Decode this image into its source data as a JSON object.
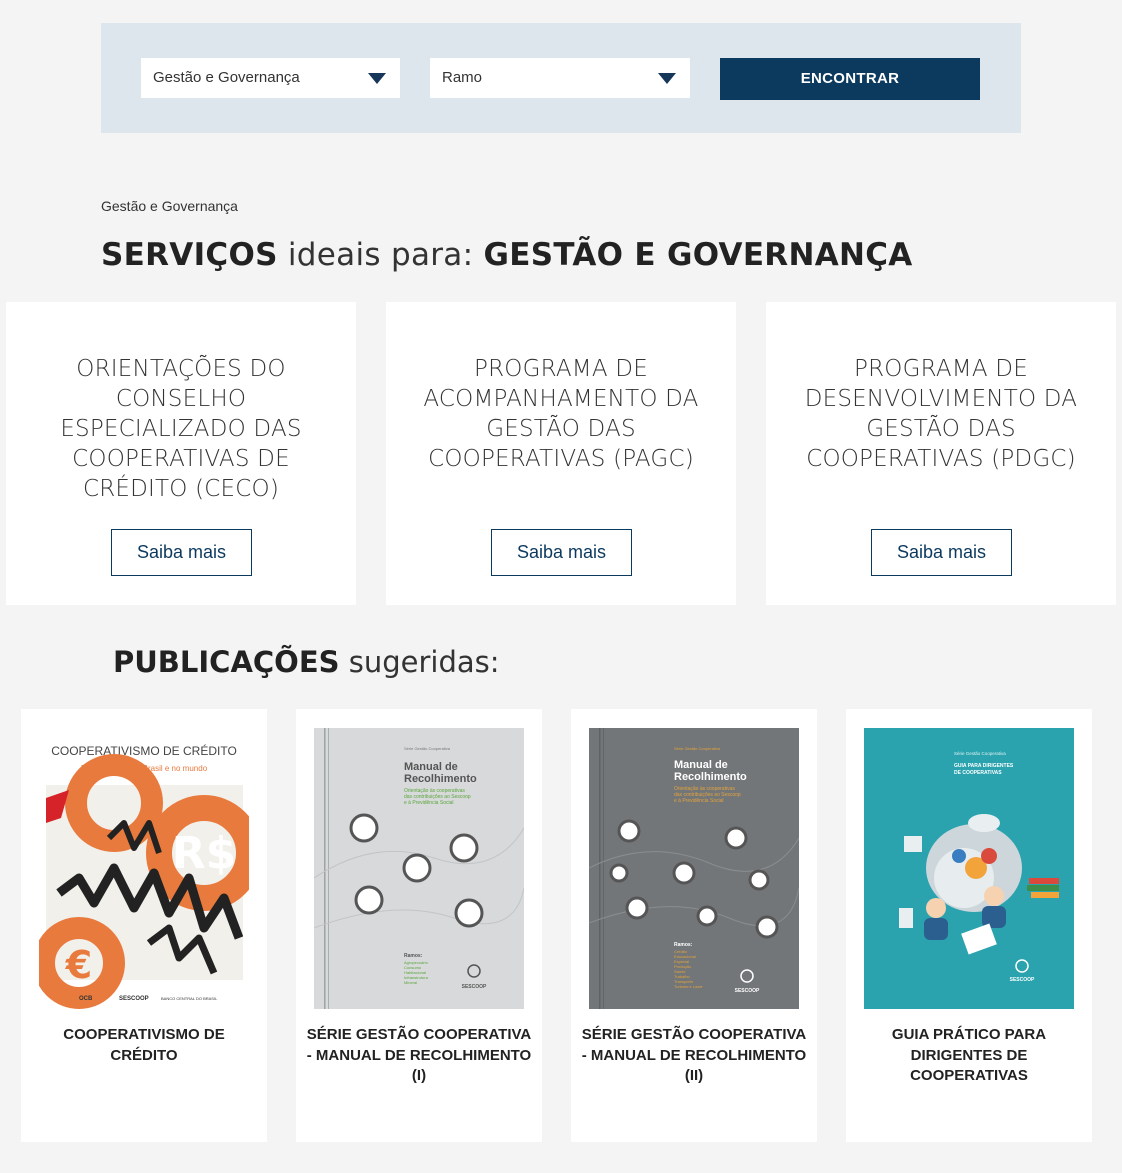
{
  "filters": {
    "theme_value": "Gestão e Governança",
    "branch_value": "Ramo",
    "find_label": "ENCONTRAR"
  },
  "breadcrumb": "Gestão e Governança",
  "services_heading": {
    "bold1": "SERVIÇOS",
    "light": " ideais para: ",
    "bold2": "GESTÃO E GOVERNANÇA"
  },
  "services": [
    {
      "title": "ORIENTAÇÕES DO CONSELHO ESPECIALIZADO DAS COOPERATIVAS DE CRÉDITO (CECO)",
      "button": "Saiba mais"
    },
    {
      "title": "PROGRAMA DE ACOMPANHAMENTO DA GESTÃO DAS COOPERATIVAS (PAGC)",
      "button": "Saiba mais"
    },
    {
      "title": "PROGRAMA DE DESENVOLVIMENTO DA GESTÃO DAS COOPERATIVAS (PDGC)",
      "button": "Saiba mais"
    }
  ],
  "publications_heading": {
    "bold": "PUBLICAÇÕES",
    "light": " sugeridas:"
  },
  "publications": [
    {
      "title": "COOPERATIVISMO DE CRÉDITO",
      "cover": {
        "heading": "COOPERATIVISMO DE CRÉDITO",
        "subheading": "Boas práticas no Brasil e no mundo",
        "footer": [
          "OCB",
          "SESCOOP",
          "BANCO CENTRAL DO BRASIL"
        ]
      }
    },
    {
      "title": "SÉRIE GESTÃO COOPERATIVA - MANUAL DE RECOLHIMENTO (I)",
      "cover": {
        "series": "Série Gestão Cooperativa",
        "heading": "Manual de Recolhimento",
        "subheading": "Orientação às cooperativas das contribuições ao Sescoop e à Previdência Social",
        "ramos_label": "Ramos:",
        "ramos": [
          "Agropecuário",
          "Consumo",
          "Habitacional",
          "Infraestrutura",
          "Mineral"
        ],
        "logo": "SESCOOP"
      }
    },
    {
      "title": "SÉRIE GESTÃO COOPERATIVA - MANUAL DE RECOLHIMENTO (II)",
      "cover": {
        "series": "Série Gestão Cooperativa",
        "heading": "Manual de Recolhimento",
        "subheading": "Orientação às cooperativas das contribuições ao Sescoop e à Previdência Social",
        "ramos_label": "Ramos:",
        "ramos": [
          "Crédito",
          "Educacional",
          "Especial",
          "Produção",
          "Saúde",
          "Trabalho",
          "Transporte",
          "Turismo e Lazer"
        ],
        "logo": "SESCOOP"
      }
    },
    {
      "title": "GUIA PRÁTICO PARA DIRIGENTES DE COOPERATIVAS",
      "cover": {
        "series": "Série Gestão Cooperativa",
        "heading": "GUIA PARA DIRIGENTES DE COOPERATIVAS",
        "logo": "SESCOOP"
      }
    }
  ],
  "colors": {
    "primary": "#0c3a5e",
    "filter_bg": "#dde6ec",
    "page_bg": "#f4f4f4",
    "cover_orange": "#e97a3e",
    "cover_gray_light": "#d7d9da",
    "cover_gray_dark": "#737679",
    "cover_teal": "#2aa3ae"
  }
}
